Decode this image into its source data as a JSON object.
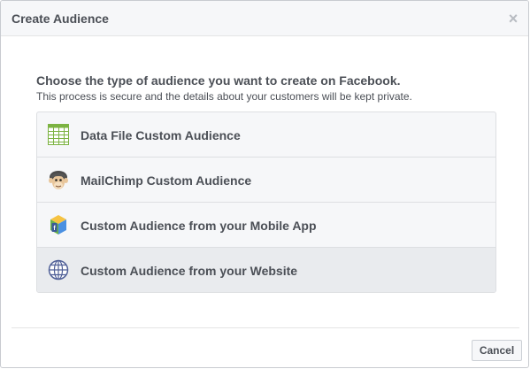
{
  "dialog": {
    "title": "Create Audience",
    "close_label": "×",
    "prompt": "Choose the type of audience you want to create on Facebook.",
    "subprompt": "This process is secure and the details about your customers will be kept private.",
    "options": [
      {
        "label": "Data File Custom Audience",
        "icon": "spreadsheet-icon"
      },
      {
        "label": "MailChimp Custom Audience",
        "icon": "mailchimp-icon"
      },
      {
        "label": "Custom Audience from your Mobile App",
        "icon": "mobile-app-icon"
      },
      {
        "label": "Custom Audience from your Website",
        "icon": "globe-icon",
        "selected": true
      }
    ],
    "cancel_label": "Cancel"
  },
  "colors": {
    "header_bg": "#f6f7f9",
    "text": "#4b4f56",
    "border": "#dddfe2",
    "selected_bg": "#e9ebee",
    "spreadsheet_green": "#7cb342",
    "globe_blue": "#4f5f97"
  }
}
